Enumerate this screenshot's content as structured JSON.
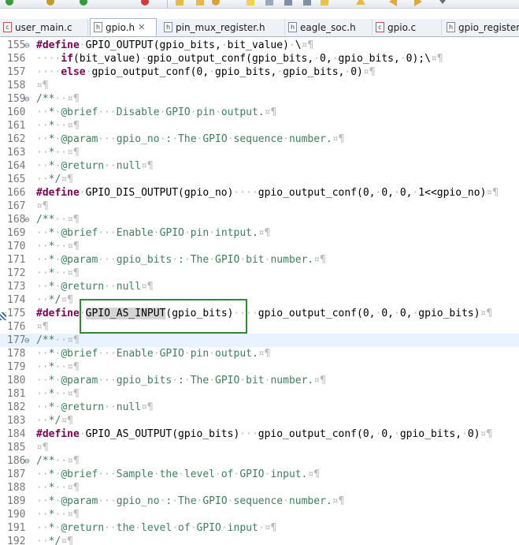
{
  "tabs": [
    {
      "label": "user_main.c",
      "icon": "c-file-icon"
    },
    {
      "label": "gpio.h",
      "icon": "h-file-icon",
      "active": true
    },
    {
      "label": "pin_mux_register.h",
      "icon": "h-file-icon"
    },
    {
      "label": "eagle_soc.h",
      "icon": "h-file-icon"
    },
    {
      "label": "gpio.c",
      "icon": "c-file-icon"
    },
    {
      "label": "gpio_register",
      "icon": "h-file-icon"
    }
  ],
  "colors": {
    "keyword": "#7f0055",
    "comment": "#3f7f5f",
    "line_number": "#787878",
    "current_line": "#e8f2fe",
    "highlight_box": "#2e8a35"
  },
  "editor": {
    "lines": [
      {
        "n": "155",
        "fold": "⊖",
        "code": "#define·GPIO_OUTPUT(gpio_bits,·bit_value)·\\¤¶"
      },
      {
        "n": "156",
        "code": "····if(bit_value)·gpio_output_conf(gpio_bits,·0,·gpio_bits,·0);\\¤¶"
      },
      {
        "n": "157",
        "code": "····else·gpio_output_conf(0,·gpio_bits,·gpio_bits,·0)¤¶"
      },
      {
        "n": "158",
        "code": "¤¶"
      },
      {
        "n": "159",
        "fold": "⊖",
        "code": "/**··¤¶"
      },
      {
        "n": "160",
        "code": "··*·@brief···Disable·GPIO·pin·output.¤¶"
      },
      {
        "n": "161",
        "code": "··*··¤¶"
      },
      {
        "n": "162",
        "code": "··*·@param···gpio_no·:·The·GPIO·sequence·number.¤¶"
      },
      {
        "n": "163",
        "code": "··*··¤¶"
      },
      {
        "n": "164",
        "code": "··*·@return··null¤¶"
      },
      {
        "n": "165",
        "code": "··*/¤¶"
      },
      {
        "n": "166",
        "code": "#define·GPIO_DIS_OUTPUT(gpio_no)····gpio_output_conf(0,·0,·0,·1<<gpio_no)¤¶"
      },
      {
        "n": "167",
        "code": "¤¶"
      },
      {
        "n": "168",
        "fold": "⊖",
        "code": "/**··¤¶"
      },
      {
        "n": "169",
        "code": "··*·@brief···Enable·GPIO·pin·intput.¤¶"
      },
      {
        "n": "170",
        "code": "··*··¤¶"
      },
      {
        "n": "171",
        "code": "··*·@param···gpio_bits·:·The·GPIO·bit·number.¤¶"
      },
      {
        "n": "172",
        "code": "··*··¤¶"
      },
      {
        "n": "173",
        "code": "··*·@return··null¤¶"
      },
      {
        "n": "174",
        "code": "··*/¤¶"
      },
      {
        "n": "175",
        "code": "#define·GPIO_AS_INPUT(gpio_bits)····gpio_output_conf(0,·0,·0,·gpio_bits)¤¶",
        "highlight": "GPIO_AS_INPUT"
      },
      {
        "n": "176",
        "code": "¤¶"
      },
      {
        "n": "177",
        "fold": "⊖",
        "code": "/**··¤¶",
        "current": true
      },
      {
        "n": "178",
        "code": "··*·@brief···Enable·GPIO·pin·output.¤¶"
      },
      {
        "n": "179",
        "code": "··*··¤¶"
      },
      {
        "n": "180",
        "code": "··*·@param···gpio_bits·:·The·GPIO·bit·number.¤¶"
      },
      {
        "n": "181",
        "code": "··*··¤¶"
      },
      {
        "n": "182",
        "code": "··*·@return··null¤¶"
      },
      {
        "n": "183",
        "code": "··*/¤¶"
      },
      {
        "n": "184",
        "code": "#define·GPIO_AS_OUTPUT(gpio_bits)···gpio_output_conf(0,·0,·gpio_bits,·0)¤¶"
      },
      {
        "n": "185",
        "code": "¤¶"
      },
      {
        "n": "186",
        "fold": "⊖",
        "code": "/**··¤¶"
      },
      {
        "n": "187",
        "code": "··*·@brief···Sample·the·level·of·GPIO·input.¤¶"
      },
      {
        "n": "188",
        "code": "··*··¤¶"
      },
      {
        "n": "189",
        "code": "··*·@param···gpio_no·:·The·GPIO·sequence·number.¤¶"
      },
      {
        "n": "190",
        "code": "··*··¤¶"
      },
      {
        "n": "191",
        "code": "··*·@return··the·level·of·GPIO·input·¤¶"
      },
      {
        "n": "192",
        "code": "··*/¤¶"
      }
    ]
  }
}
